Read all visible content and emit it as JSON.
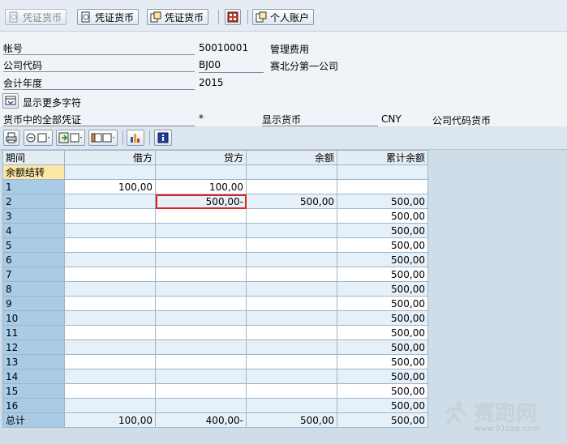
{
  "toolbar": {
    "btn1": "凭证货币",
    "btn2": "凭证货币",
    "btn3": "凭证货币",
    "btn4": "个人账户"
  },
  "header": {
    "account_label": "帐号",
    "account_value": "50010001",
    "account_desc": "管理费用",
    "company_label": "公司代码",
    "company_value": "BJ00",
    "company_desc": "赛北分第一公司",
    "year_label": "会计年度",
    "year_value": "2015",
    "more_chars_label": "显示更多字符",
    "all_docs_label": "货币中的全部凭证",
    "all_docs_value": "*",
    "display_currency_label": "显示货币",
    "display_currency_value": "CNY",
    "currency_desc": "公司代码货币"
  },
  "grid": {
    "columns": [
      "期间",
      "借方",
      "贷方",
      "余额",
      "累计余额"
    ],
    "rows": [
      {
        "period": "余额结转",
        "debit": "",
        "credit": "",
        "balance": "",
        "cumulative": ""
      },
      {
        "period": "1",
        "debit": "100,00",
        "credit": "100,00",
        "balance": "",
        "cumulative": ""
      },
      {
        "period": "2",
        "debit": "",
        "credit": "500,00-",
        "balance": "500,00",
        "cumulative": "500,00"
      },
      {
        "period": "3",
        "debit": "",
        "credit": "",
        "balance": "",
        "cumulative": "500,00"
      },
      {
        "period": "4",
        "debit": "",
        "credit": "",
        "balance": "",
        "cumulative": "500,00"
      },
      {
        "period": "5",
        "debit": "",
        "credit": "",
        "balance": "",
        "cumulative": "500,00"
      },
      {
        "period": "6",
        "debit": "",
        "credit": "",
        "balance": "",
        "cumulative": "500,00"
      },
      {
        "period": "7",
        "debit": "",
        "credit": "",
        "balance": "",
        "cumulative": "500,00"
      },
      {
        "period": "8",
        "debit": "",
        "credit": "",
        "balance": "",
        "cumulative": "500,00"
      },
      {
        "period": "9",
        "debit": "",
        "credit": "",
        "balance": "",
        "cumulative": "500,00"
      },
      {
        "period": "10",
        "debit": "",
        "credit": "",
        "balance": "",
        "cumulative": "500,00"
      },
      {
        "period": "11",
        "debit": "",
        "credit": "",
        "balance": "",
        "cumulative": "500,00"
      },
      {
        "period": "12",
        "debit": "",
        "credit": "",
        "balance": "",
        "cumulative": "500,00"
      },
      {
        "period": "13",
        "debit": "",
        "credit": "",
        "balance": "",
        "cumulative": "500,00"
      },
      {
        "period": "14",
        "debit": "",
        "credit": "",
        "balance": "",
        "cumulative": "500,00"
      },
      {
        "period": "15",
        "debit": "",
        "credit": "",
        "balance": "",
        "cumulative": "500,00"
      },
      {
        "period": "16",
        "debit": "",
        "credit": "",
        "balance": "",
        "cumulative": "500,00"
      }
    ],
    "total": {
      "period": "总计",
      "debit": "100,00",
      "credit": "400,00-",
      "balance": "500,00",
      "cumulative": "500,00"
    }
  },
  "watermark": {
    "text": "赛跑网",
    "url": "www.91sap.com"
  },
  "icons": {
    "doc_currency": "document-currency-icon",
    "personal_account": "personal-account-icon",
    "more_chars": "expand-chars-icon",
    "print": "print-icon",
    "filter": "filter-icon",
    "export": "export-icon",
    "layout": "layout-icon",
    "chart": "chart-icon",
    "info": "info-icon"
  },
  "colors": {
    "row_header": "#a9cbe6",
    "highlight_row_header": "#fbe7a6",
    "selection_border": "#e02020"
  }
}
